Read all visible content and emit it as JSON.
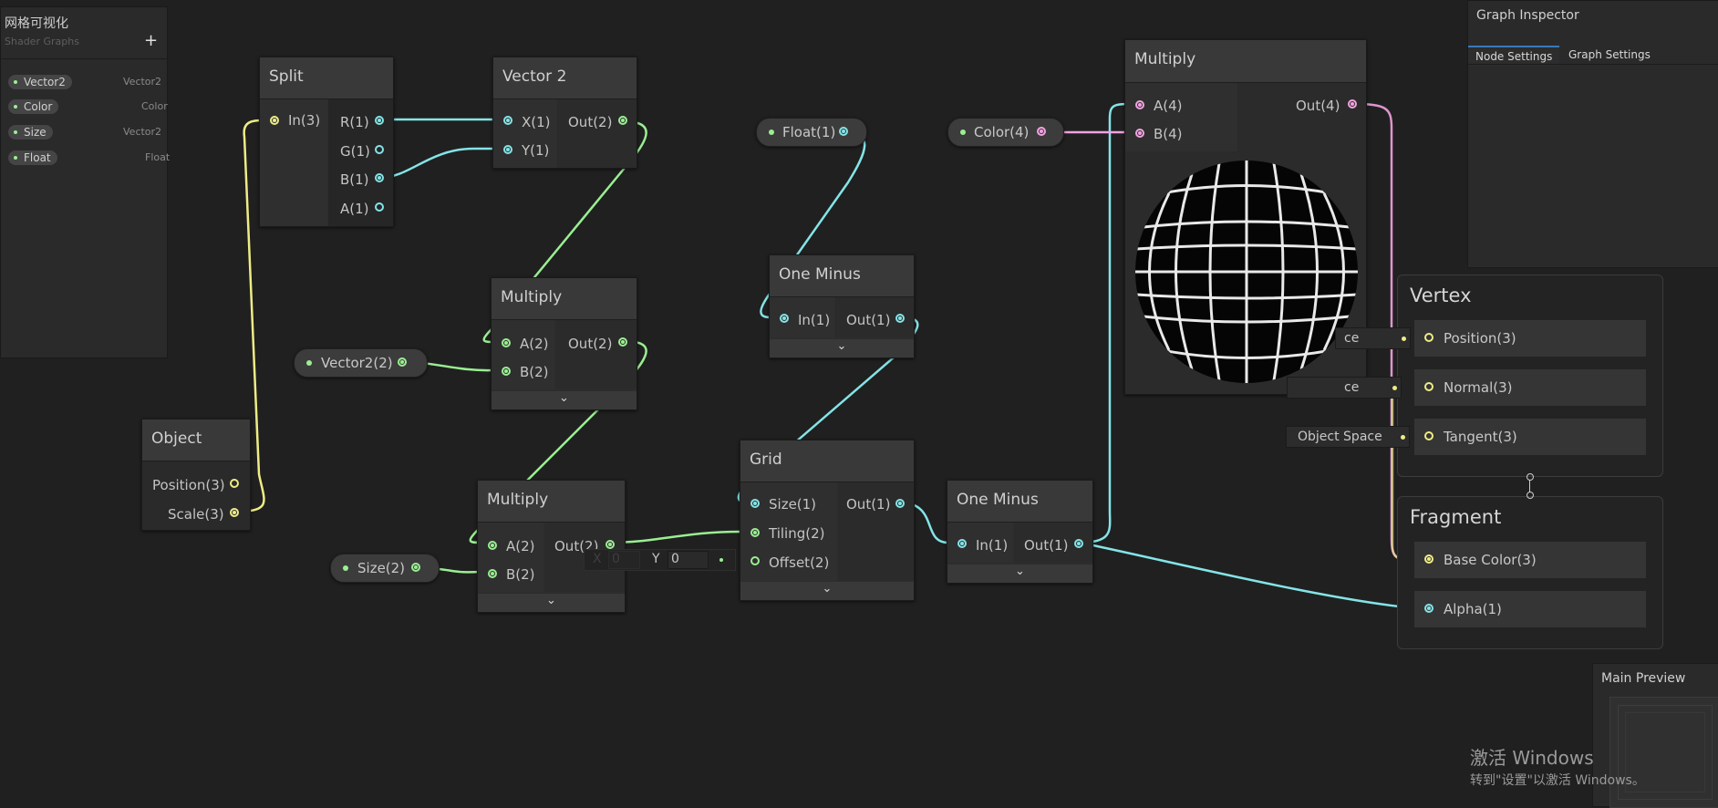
{
  "blackboard": {
    "title": "网格可视化",
    "subtitle": "Shader Graphs",
    "add_label": "+",
    "properties": [
      {
        "name": "Vector2",
        "type": "Vector2"
      },
      {
        "name": "Color",
        "type": "Color"
      },
      {
        "name": "Size",
        "type": "Vector2"
      },
      {
        "name": "Float",
        "type": "Float"
      }
    ]
  },
  "nodes": {
    "split": {
      "title": "Split",
      "in": "In(3)",
      "outs": [
        "R(1)",
        "G(1)",
        "B(1)",
        "A(1)"
      ]
    },
    "vector2": {
      "title": "Vector 2",
      "ins": [
        "X(1)",
        "Y(1)"
      ],
      "out": "Out(2)"
    },
    "multiply_top": {
      "title": "Multiply",
      "ins": [
        "A(2)",
        "B(2)"
      ],
      "out": "Out(2)"
    },
    "multiply_bottom": {
      "title": "Multiply",
      "ins": [
        "A(2)",
        "B(2)"
      ],
      "out": "Out(2)"
    },
    "object": {
      "title": "Object",
      "outs": [
        "Position(3)",
        "Scale(3)"
      ]
    },
    "one_minus_top": {
      "title": "One Minus",
      "in": "In(1)",
      "out": "Out(1)"
    },
    "one_minus_bottom": {
      "title": "One Minus",
      "in": "In(1)",
      "out": "Out(1)"
    },
    "grid": {
      "title": "Grid",
      "ins": [
        "Size(1)",
        "Tiling(2)",
        "Offset(2)"
      ],
      "out": "Out(1)",
      "offset_x_label": "X",
      "offset_x_value": "0",
      "offset_y_label": "Y",
      "offset_y_value": "0"
    },
    "multiply_preview": {
      "title": "Multiply",
      "ins": [
        "A(4)",
        "B(4)"
      ],
      "out": "Out(4)"
    }
  },
  "property_nodes": {
    "float": "Float(1)",
    "color": "Color(4)",
    "vector2": "Vector2(2)",
    "size": "Size(2)"
  },
  "master": {
    "vertex_title": "Vertex",
    "vertex_ports": [
      "Position(3)",
      "Normal(3)",
      "Tangent(3)"
    ],
    "fragment_title": "Fragment",
    "fragment_ports": [
      "Base Color(3)",
      "Alpha(1)"
    ],
    "space_labels": [
      "ce",
      "ce",
      "Object Space"
    ]
  },
  "inspector": {
    "title": "Graph Inspector",
    "tabs": [
      "Node Settings",
      "Graph Settings"
    ]
  },
  "main_preview": {
    "title": "Main Preview"
  },
  "watermark": {
    "line1": "激活 Windows",
    "line2": "转到\"设置\"以激活 Windows。"
  },
  "colors": {
    "background": "#202020",
    "port_vector3": "#eeec85",
    "port_float": "#84e4e7",
    "port_vector2": "#9aef92",
    "port_vector4": "#f2a2e1"
  }
}
